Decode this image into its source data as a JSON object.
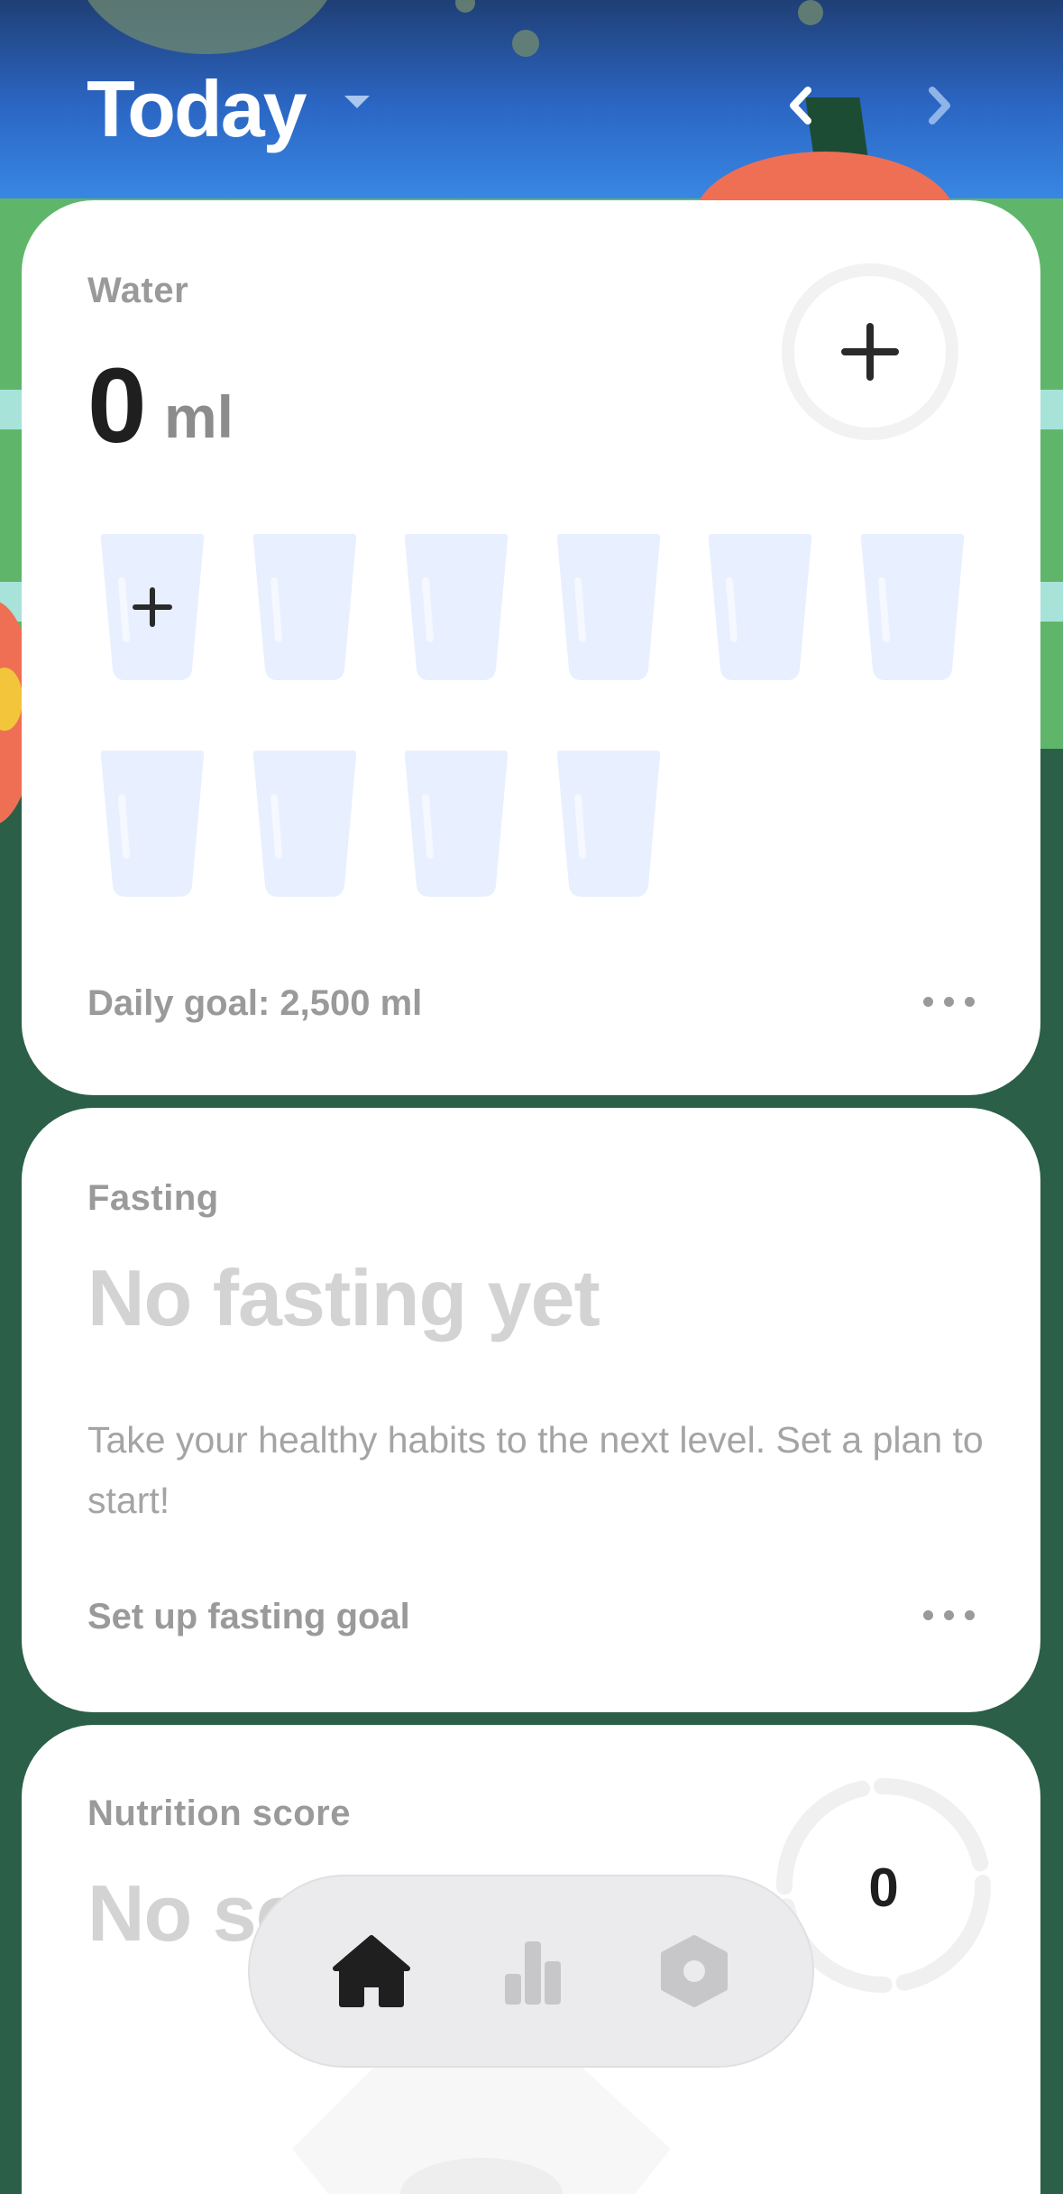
{
  "header": {
    "title": "Today"
  },
  "water": {
    "label": "Water",
    "amount": "0",
    "unit": "ml",
    "glasses_total": 10,
    "glasses_filled": 0,
    "goal_text": "Daily goal: 2,500 ml"
  },
  "fasting": {
    "label": "Fasting",
    "title": "No fasting yet",
    "description": "Take your healthy habits to the next level. Set a plan to start!",
    "action": "Set up fasting goal"
  },
  "nutrition": {
    "label": "Nutrition score",
    "title_partial": "No sc",
    "score": "0"
  },
  "tabbar": {
    "active": "home",
    "items": [
      "home-icon",
      "stats-icon",
      "settings-icon"
    ]
  },
  "colors": {
    "accent": "#1f1f1f",
    "card": "#ffffff",
    "muted": "#9a9a9a",
    "glass": "#e8efff"
  }
}
